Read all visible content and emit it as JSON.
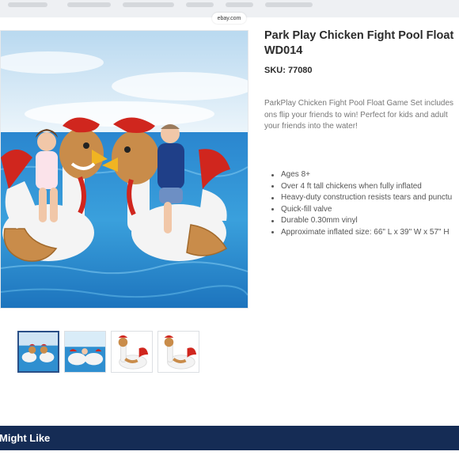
{
  "nav": {
    "items": [
      "",
      "",
      "",
      "",
      "",
      ""
    ]
  },
  "product": {
    "title": "Park Play Chicken Fight Pool Float WD014",
    "sku_label": "SKU:",
    "sku_value": "77080",
    "description_lines": [
      "ParkPlay Chicken Fight Pool Float Game Set includes",
      "ons flip your friends to win! Perfect for kids and adult",
      "your friends into the water!"
    ],
    "features": [
      "Ages 8+",
      "Over 4 ft tall chickens when fully inflated",
      "Heavy-duty construction resists tears and punctu",
      "Quick-fill valve",
      "Durable 0.30mm vinyl",
      "Approximate inflated size: 66\" L x 39\" W x 57\" H"
    ]
  },
  "image_badge": "ebay.com",
  "thumbnails": [
    {
      "name": "thumb-pool-scene",
      "active": true
    },
    {
      "name": "thumb-riders-close",
      "active": false
    },
    {
      "name": "thumb-chicken-float-1",
      "active": false
    },
    {
      "name": "thumb-chicken-float-2",
      "active": false
    }
  ],
  "section": {
    "might_like": "Might Like"
  },
  "colors": {
    "navy_banner": "#152c55",
    "active_thumb_border": "#2a4f87",
    "pool_water": "#2f8fd0",
    "sky": "#d9ecf8",
    "rooster_red": "#d0261e",
    "rooster_beak": "#f0b422",
    "float_white": "#f3f3f3",
    "wing_tan": "#c98c4a"
  }
}
